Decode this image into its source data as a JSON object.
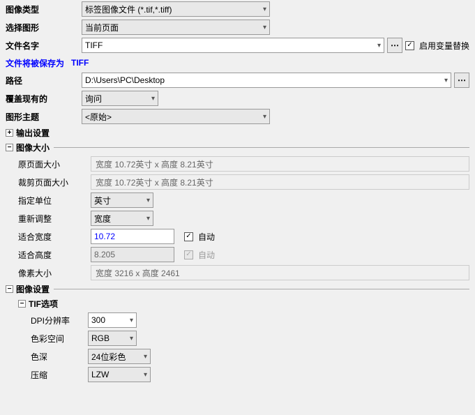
{
  "labels": {
    "image_type": "图像类型",
    "select_shape": "选择图形",
    "file_name": "文件名字",
    "saved_as_prefix": "文件将被保存为",
    "saved_as_value": "TIFF",
    "enable_var": "启用变量替换",
    "path": "路径",
    "overwrite": "覆盖现有的",
    "shape_theme": "图形主题",
    "output_settings": "输出设置",
    "image_size": "图像大小",
    "orig_page_size": "原页面大小",
    "crop_page_size": "裁剪页面大小",
    "unit": "指定单位",
    "resize": "重新调整",
    "fit_width": "适合宽度",
    "fit_height": "适合高度",
    "pixel_size": "像素大小",
    "auto": "自动",
    "image_settings": "图像设置",
    "tif_options": "TIF选项",
    "dpi": "DPI分辨率",
    "color_space": "色彩空间",
    "color_depth": "色深",
    "compression": "压缩"
  },
  "values": {
    "image_type": "标签图像文件 (*.tif,*.tiff)",
    "select_shape": "当前页面",
    "file_name": "TIFF",
    "path": "D:\\Users\\PC\\Desktop",
    "overwrite": "询问",
    "shape_theme": "<原始>",
    "orig_page_size": "宽度 10.72英寸 x 高度 8.21英寸",
    "crop_page_size": "宽度 10.72英寸 x 高度 8.21英寸",
    "unit": "英寸",
    "resize": "宽度",
    "fit_width": "10.72",
    "fit_height": "8.205",
    "pixel_size": "宽度 3216 x 高度 2461",
    "dpi": "300",
    "color_space": "RGB",
    "color_depth": "24位彩色",
    "compression": "LZW"
  },
  "icons": {
    "more": "⋯",
    "plus": "+",
    "minus": "−",
    "check": "✓",
    "dropdown": "▾"
  }
}
